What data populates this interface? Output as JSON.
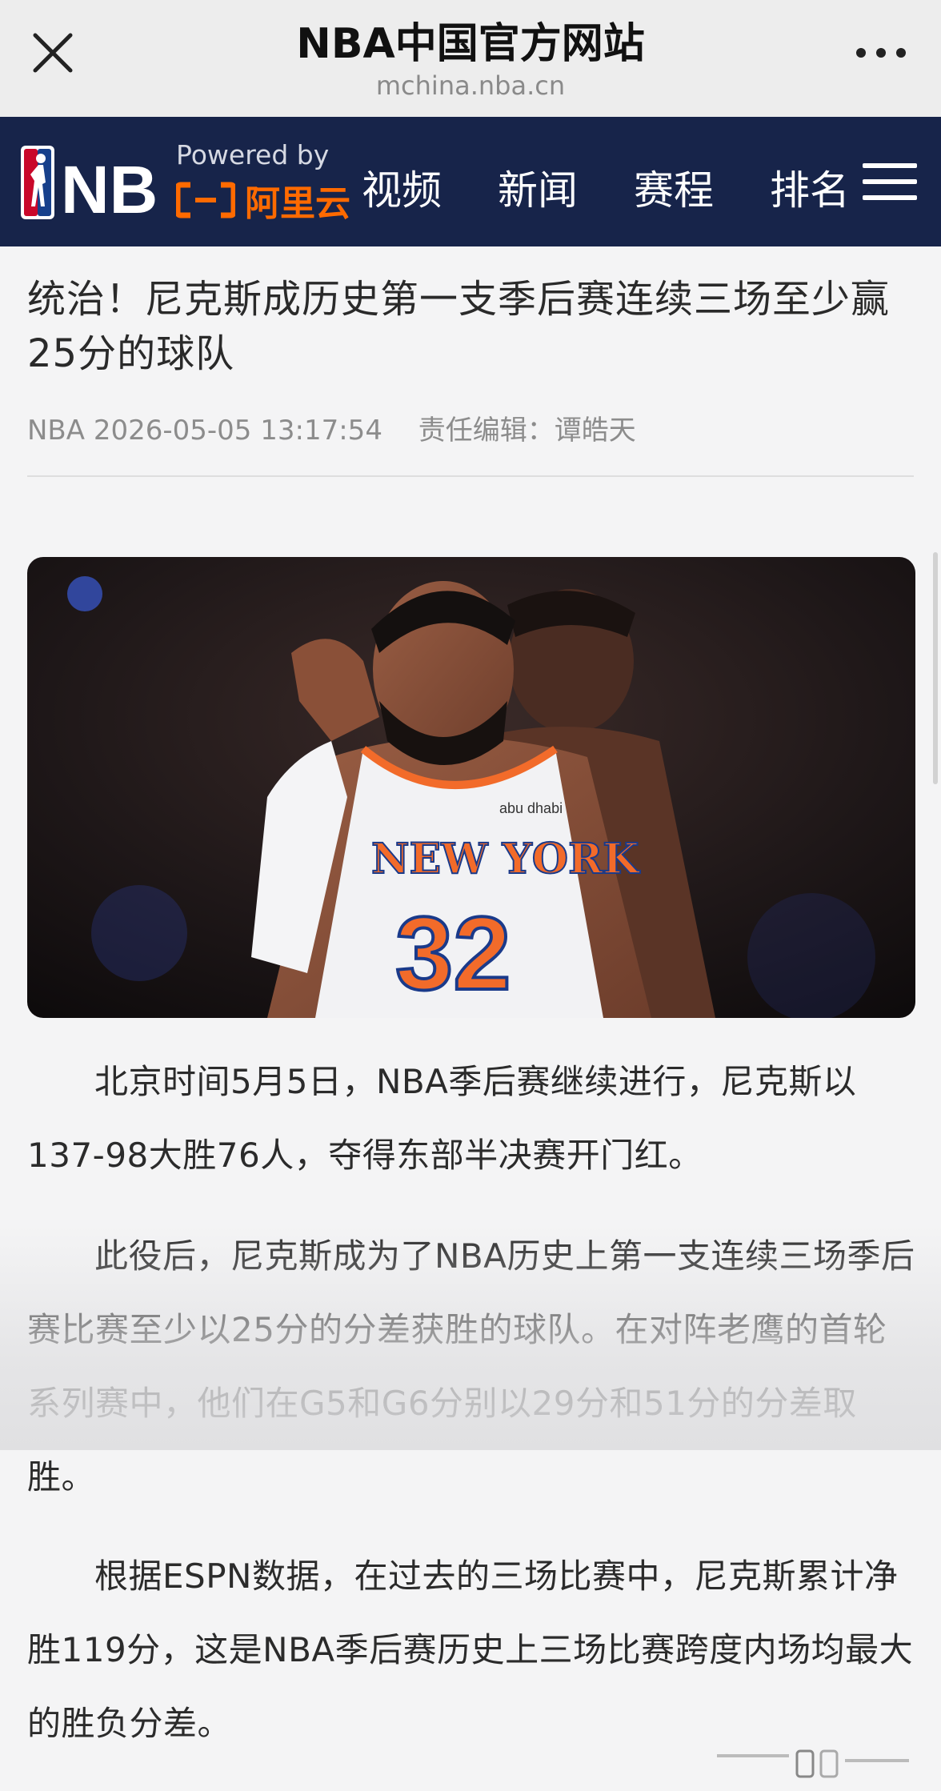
{
  "browser": {
    "title": "NBA中国官方网站",
    "url": "mchina.nba.cn",
    "close_icon": "close-icon",
    "more_icon": "more-dots-icon"
  },
  "nav": {
    "logo_text": "NBA",
    "powered_by": "Powered by",
    "partner": "阿里云",
    "items": [
      {
        "label": "视频"
      },
      {
        "label": "新闻"
      },
      {
        "label": "赛程"
      },
      {
        "label": "排名"
      }
    ],
    "menu_icon": "hamburger-menu-icon",
    "colors": {
      "bar": "#17244a",
      "partner": "#ff6a00"
    }
  },
  "article": {
    "title": "统治！尼克斯成历史第一支季后赛连续三场至少赢25分的球队",
    "source": "NBA",
    "datetime": "2026-05-05 13:17:54",
    "editor": "责任编辑：谭皓天",
    "photo": {
      "jersey_text": "NEW YORK",
      "jersey_number": "32",
      "sponsor": "abu dhabi"
    },
    "paragraphs": [
      "北京时间5月5日，NBA季后赛继续进行，尼克斯以137-98大胜76人，夺得东部半决赛开门红。",
      "此役后，尼克斯成为了NBA历史上第一支连续三场季后赛比赛至少以25分的分差获胜的球队。在对阵老鹰的首轮系列赛中，他们在G5和G6分别以29分和51分的分差取胜。",
      "根据ESPN数据，在过去的三场比赛中，尼克斯累计净胜119分，这是NBA季后赛历史上三场比赛跨度内场均最大的胜负分差。"
    ]
  }
}
